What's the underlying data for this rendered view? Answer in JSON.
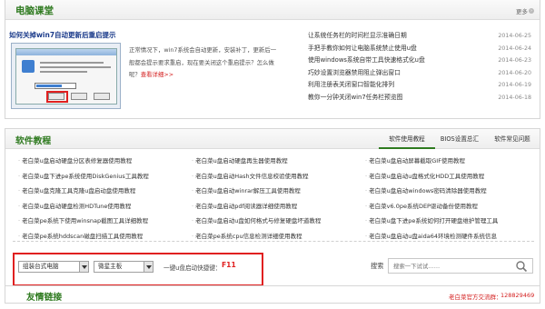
{
  "computer_class": {
    "title": "电脑课堂",
    "more_label": "更多",
    "featured": {
      "title": "如何关掉win7自动更新后重启提示",
      "description": "正常情况下，win7系统会自动更新，安装补丁，更新后一般都会提示要求重启，现在要关闭这个重启提示？怎么做呢？",
      "more_link": "查看详细>>"
    },
    "news": [
      {
        "title": "让系统任务栏的时间栏显示准确日期",
        "date": "2014-06-25"
      },
      {
        "title": "手把手教你如何让电脑系统禁止使用u盘",
        "date": "2014-06-24"
      },
      {
        "title": "使用windows系统自带工具快速格式化u盘",
        "date": "2014-06-23"
      },
      {
        "title": "巧妙设置浏览器禁用阻止弹出窗口",
        "date": "2014-06-20"
      },
      {
        "title": "利用注册表关闭窗口智能化排列",
        "date": "2014-06-19"
      },
      {
        "title": "教你一分钟关闭win7任务栏预览图",
        "date": "2014-06-18"
      }
    ]
  },
  "software_tutorials": {
    "title": "软件教程",
    "tabs": [
      "软件使用教程",
      "BIOS设置总汇",
      "软件常见问题"
    ],
    "active_tab": 0,
    "columns": [
      [
        "老白菜u盘启动硬盘分区表修复器使用教程",
        "老白菜u盘下进pe系统使用DiskGenius工具教程",
        "老白菜u盘克隆工具克隆u盘启动盘使用教程",
        "老白菜u盘启动硬盘检测HDTune使用教程",
        "老白菜pe系统下使用winsnap截图工具详细教程",
        "老白菜pe系统hddscan磁盘扫描工具使用教程"
      ],
      [
        "老白菜u盘启动硬盘再生器使用教程",
        "老白菜u盘启动Hash文件信息校验使用教程",
        "老白菜u盘启动winrar解压工具使用教程",
        "老白菜u盘启动pdf阅读器详细使用教程",
        "老白菜u盘启动u盘如何格式与修复硬盘坏道教程",
        "老白菜pe系统cpu信息检测详细使用教程"
      ],
      [
        "老白菜u盘启动屏幕截取GIF使用教程",
        "老白菜u盘启动u盘格式化HDD工具使用教程",
        "老白菜u盘启动windows密码清除器使用教程",
        "老白菜v6.0pe系统DEP驱动备份使用教程",
        "老白菜u盘下进pe系统如何打开硬盘维护管理工具",
        "老白菜u盘启动u盘aida64环境检测硬件系统信息"
      ]
    ],
    "selector": {
      "machine_type": "组装台式电脑",
      "motherboard": "微星主板",
      "hotkey_label": "一键u盘启动快捷键：",
      "hotkey_value": "F11"
    },
    "search": {
      "label": "搜索",
      "placeholder": "搜索一下试试……"
    }
  },
  "friend_links": {
    "title": "友情链接",
    "qq_label": "老白菜官方交流群：",
    "qq_value": "128829469"
  },
  "colors": {
    "section_title": "#2e7a1f",
    "highlight_red": "#e02020",
    "featured_title": "#1a3a8a"
  },
  "icons": {
    "more": "chevron-right-circle-icon",
    "search": "magnifier-icon",
    "dropdown": "triangle-down-icon"
  }
}
